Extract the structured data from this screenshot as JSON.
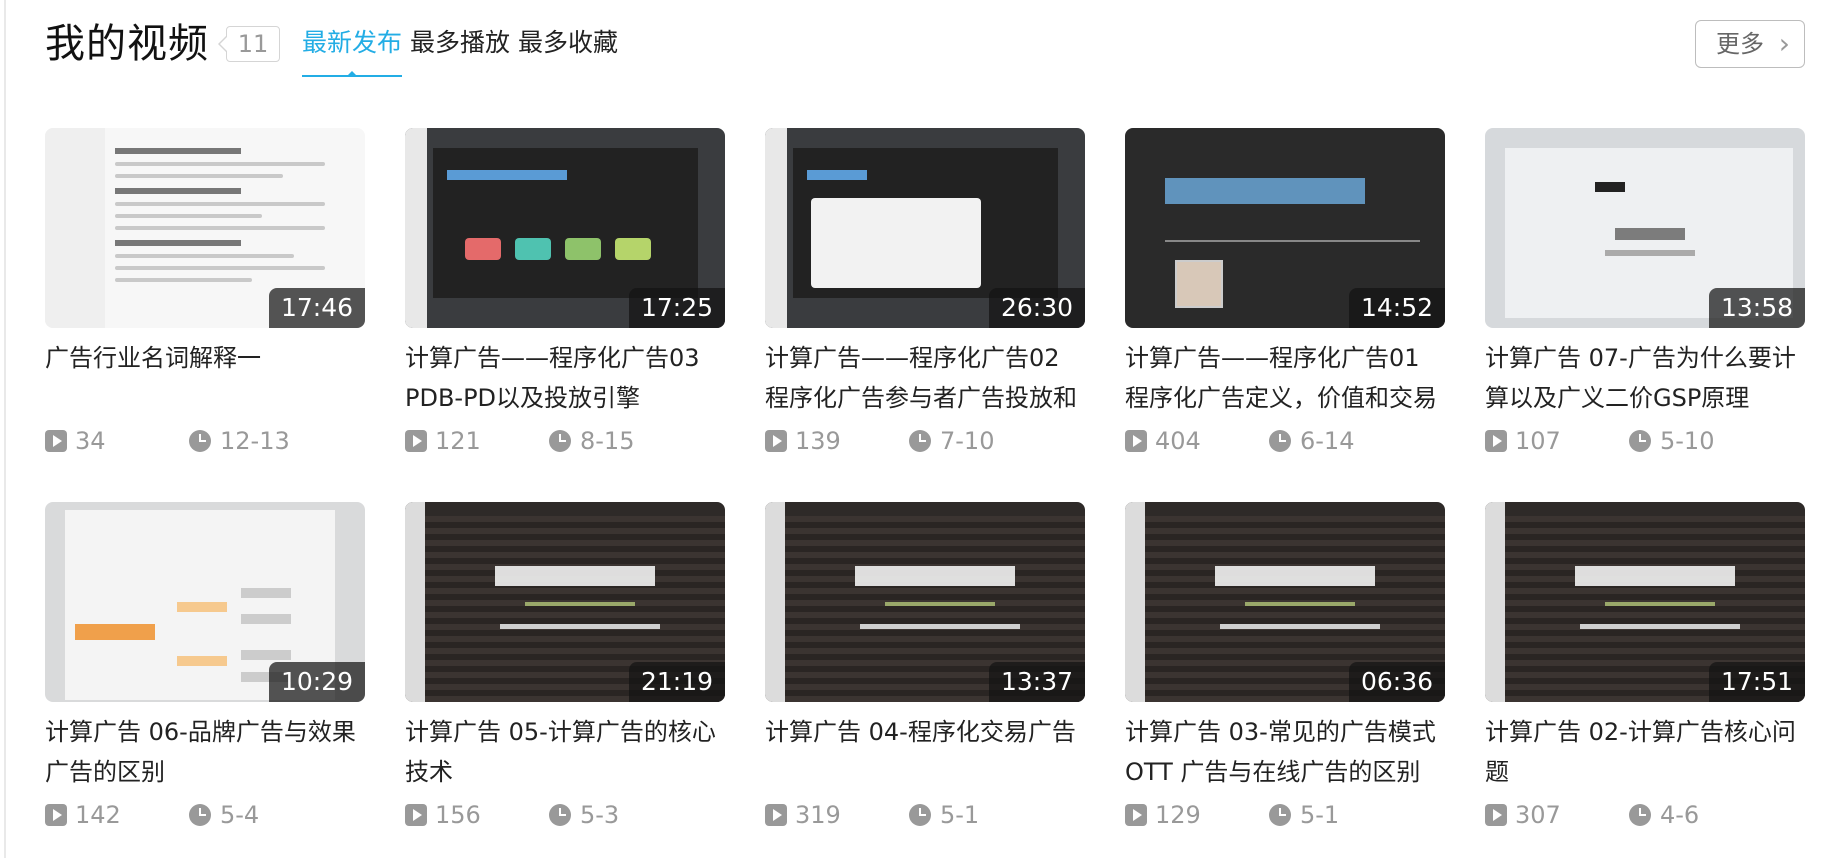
{
  "header": {
    "title": "我的视频",
    "count": "11",
    "tabs": [
      {
        "label": "最新发布",
        "active": true
      },
      {
        "label": "最多播放",
        "active": false
      },
      {
        "label": "最多收藏",
        "active": false
      }
    ],
    "more_label": "更多"
  },
  "colors": {
    "accent": "#23ade5",
    "meta": "#999999"
  },
  "videos": [
    {
      "title": "广告行业名词解释一",
      "duration": "17:46",
      "plays": "34",
      "date": "12-13"
    },
    {
      "title": "计算广告——程序化广告03 PDB-PD以及投放引擎",
      "duration": "17:25",
      "plays": "121",
      "date": "8-15"
    },
    {
      "title": "计算广告——程序化广告02 程序化广告参与者广告投放和",
      "duration": "26:30",
      "plays": "139",
      "date": "7-10"
    },
    {
      "title": "计算广告——程序化广告01 程序化广告定义，价值和交易",
      "duration": "14:52",
      "plays": "404",
      "date": "6-14"
    },
    {
      "title": "计算广告 07-广告为什么要计算以及广义二价GSP原理",
      "duration": "13:58",
      "plays": "107",
      "date": "5-10"
    },
    {
      "title": "计算广告 06-品牌广告与效果广告的区别",
      "duration": "10:29",
      "plays": "142",
      "date": "5-4"
    },
    {
      "title": "计算广告 05-计算广告的核心技术",
      "duration": "21:19",
      "plays": "156",
      "date": "5-3"
    },
    {
      "title": "计算广告 04-程序化交易广告",
      "duration": "13:37",
      "plays": "319",
      "date": "5-1"
    },
    {
      "title": "计算广告 03-常见的广告模式OTT 广告与在线广告的区别",
      "duration": "06:36",
      "plays": "129",
      "date": "5-1"
    },
    {
      "title": "计算广告 02-计算广告核心问题",
      "duration": "17:51",
      "plays": "307",
      "date": "4-6"
    }
  ]
}
